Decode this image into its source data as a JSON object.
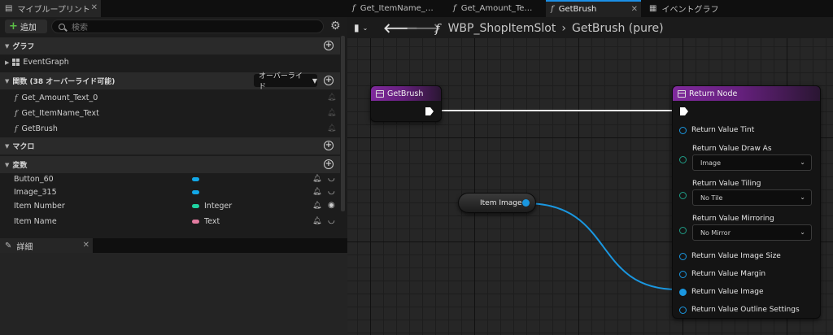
{
  "tabs": [
    {
      "label": "マイブループリント",
      "active": false
    },
    {
      "label": "Get_ItemName_…",
      "active": false
    },
    {
      "label": "Get_Amount_Te…",
      "active": false
    },
    {
      "label": "GetBrush",
      "active": true
    },
    {
      "label": "イベントグラフ",
      "active": false
    }
  ],
  "left_panel": {
    "add_label": "追加",
    "search_placeholder": "検索",
    "sections": {
      "graphs": "グラフ",
      "functions": "関数 (38 オーバーライド可能)",
      "macros": "マクロ",
      "variables": "変数"
    },
    "override_label": "オーバーライド",
    "event_graph": "EventGraph",
    "functions": [
      "Get_Amount_Text_0",
      "Get_ItemName_Text",
      "GetBrush"
    ],
    "variables": [
      {
        "name": "Button_60",
        "type": "",
        "color": "#12a8e8",
        "eye": false
      },
      {
        "name": "Image_315",
        "type": "",
        "color": "#12a8e8",
        "eye": false
      },
      {
        "name": "Item Number",
        "type": "Integer",
        "color": "#1fd3a0",
        "eye": true
      },
      {
        "name": "Item Name",
        "type": "Text",
        "color": "#e27ba0",
        "eye": false
      }
    ],
    "details_tab": "詳細"
  },
  "graph": {
    "breadcrumb_blueprint": "WBP_ShopItemSlot",
    "breadcrumb_function": "GetBrush (pure)",
    "entry_node_title": "GetBrush",
    "return_node_title": "Return Node",
    "return_pins": {
      "tint": "Return Value Tint",
      "draw_as": "Return Value Draw As",
      "draw_as_value": "Image",
      "tiling": "Return Value Tiling",
      "tiling_value": "No Tile",
      "mirroring": "Return Value Mirroring",
      "mirroring_value": "No Mirror",
      "image_size": "Return Value Image Size",
      "margin": "Return Value Margin",
      "image": "Return Value Image",
      "outline": "Return Value Outline Settings"
    },
    "variable_node_label": "Item Image"
  },
  "colors": {
    "accent_blue": "#1a97e0",
    "function_purple": "#7f2a9c",
    "enum_teal": "#1f9c86"
  }
}
